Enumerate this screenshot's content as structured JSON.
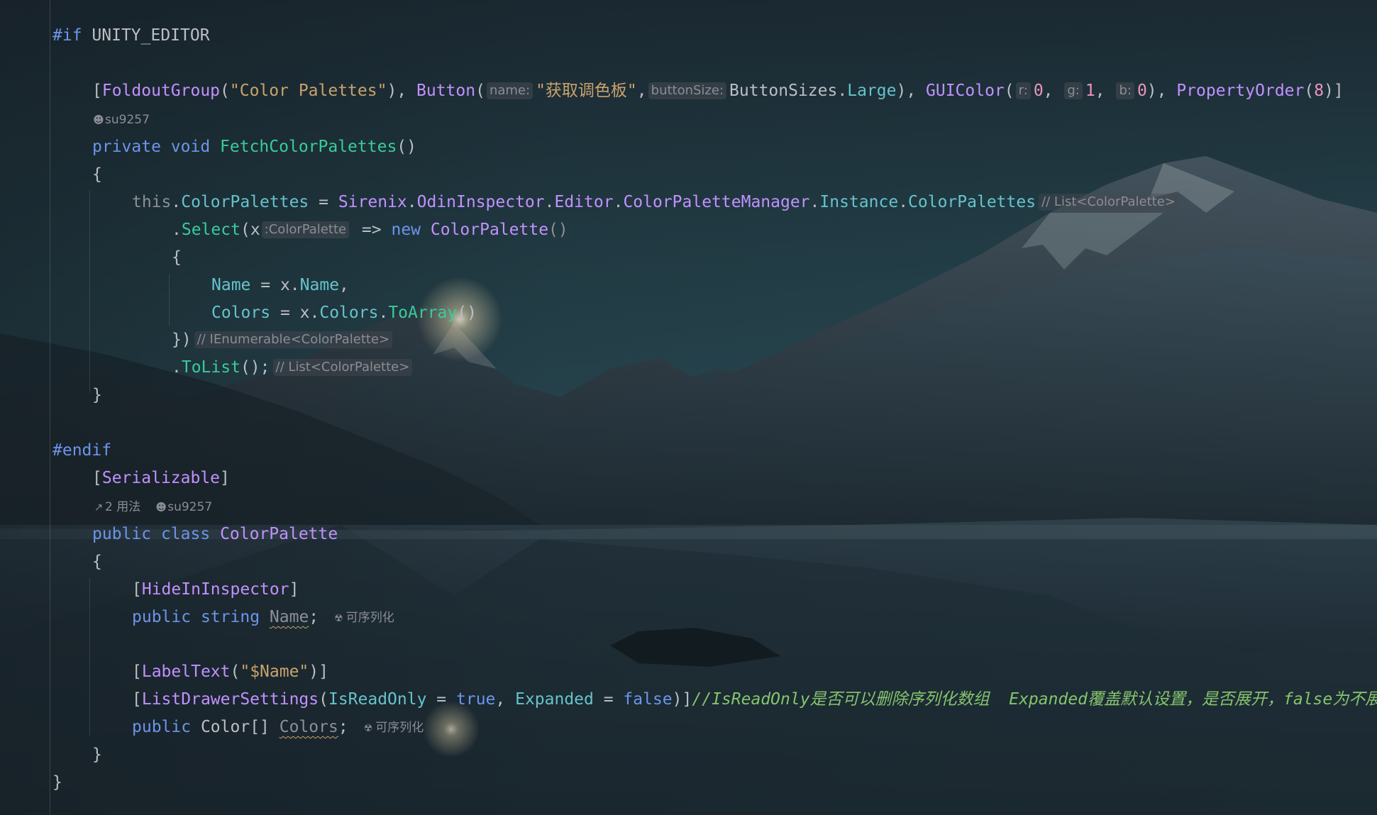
{
  "colors": {
    "keyword": "#6c95eb",
    "attribute": "#c191ff",
    "string": "#c9a26d",
    "number": "#ed94c0",
    "method": "#39cc9b",
    "property": "#66c3cc",
    "comment": "#85c46c",
    "hint": "#8a8d93"
  },
  "code": {
    "l1": {
      "pp": "#if",
      "sym": "UNITY_EDITOR"
    },
    "l2": {
      "attr_foldout": "FoldoutGroup",
      "str_palettes": "\"Color Palettes\"",
      "attr_button": "Button",
      "hint_name": "name:",
      "str_fetch": "\"获取调色板\"",
      "hint_buttonsize": "buttonSize:",
      "enum_type": "ButtonSizes",
      "enum_value": "Large",
      "attr_guicolor": "GUIColor",
      "hint_r": "r:",
      "num_r": "0",
      "hint_g": "g:",
      "num_g": "1",
      "hint_b": "b:",
      "num_b": "0",
      "attr_order": "PropertyOrder",
      "num_order": "8"
    },
    "meta1": {
      "author_icon": "person-icon",
      "author": "su9257"
    },
    "l3": {
      "kw_private": "private",
      "kw_void": "void",
      "method": "FetchColorPalettes"
    },
    "l5": {
      "kw_this": "this",
      "prop_palettes": "ColorPalettes",
      "ns1": "Sirenix",
      "ns2": "OdinInspector",
      "ns3": "Editor",
      "cls_manager": "ColorPaletteManager",
      "prop_instance": "Instance",
      "prop_palettes2": "ColorPalettes",
      "type_hint": "// List<ColorPalette>"
    },
    "l6": {
      "method_select": "Select",
      "param_x": "x",
      "hint_type": ":ColorPalette",
      "kw_new": "new",
      "cls_palette": "ColorPalette"
    },
    "l8": {
      "prop_name": "Name",
      "var_x": "x",
      "prop_name2": "Name"
    },
    "l9": {
      "prop_colors": "Colors",
      "var_x": "x",
      "prop_colors2": "Colors",
      "method_toarray": "ToArray"
    },
    "l10": {
      "type_hint": "// IEnumerable<ColorPalette>"
    },
    "l11": {
      "method_tolist": "ToList",
      "type_hint": "// List<ColorPalette>"
    },
    "l13": {
      "pp": "#endif"
    },
    "l14": {
      "attr": "Serializable"
    },
    "meta2": {
      "usage_icon": "usages-icon",
      "usages": "2 用法",
      "author_icon": "person-icon",
      "author": "su9257"
    },
    "l15": {
      "kw_public": "public",
      "kw_class": "class",
      "cls": "ColorPalette"
    },
    "l17": {
      "attr": "HideInInspector"
    },
    "l18": {
      "kw_public": "public",
      "kw_string": "string",
      "field": "Name",
      "inlay_icon": "serializable-icon",
      "inlay": "可序列化"
    },
    "l19": {
      "attr": "LabelText",
      "str": "\"$Name\""
    },
    "l20": {
      "attr": "ListDrawerSettings",
      "prop_readonly": "IsReadOnly",
      "kw_true": "true",
      "prop_expanded": "Expanded",
      "kw_false": "false",
      "comment": "//IsReadOnly是否可以删除序列化数组  Expanded覆盖默认设置，是否展开，false为不展开"
    },
    "l21": {
      "kw_public": "public",
      "type": "Color",
      "field": "Colors",
      "inlay_icon": "serializable-icon",
      "inlay": "可序列化"
    }
  }
}
